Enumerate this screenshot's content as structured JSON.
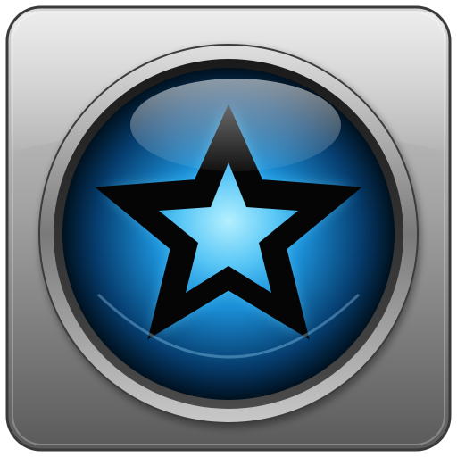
{
  "icon": {
    "name": "star-button-icon",
    "colors": {
      "tile_light": "#d4d4d4",
      "tile_mid": "#9a9a9a",
      "tile_dark": "#5e5e5e",
      "tile_border": "#3c3c3c",
      "ring_light": "#bfbfbf",
      "ring_dark": "#2a2a2a",
      "orb_center": "#63d2ff",
      "orb_mid": "#1a8fd4",
      "orb_edge": "#001a33",
      "star_fill_light": "#a8ecff",
      "star_fill_dark": "#2fa8e8",
      "star_outline": "#050505",
      "glow": "#4fd0ff"
    }
  }
}
